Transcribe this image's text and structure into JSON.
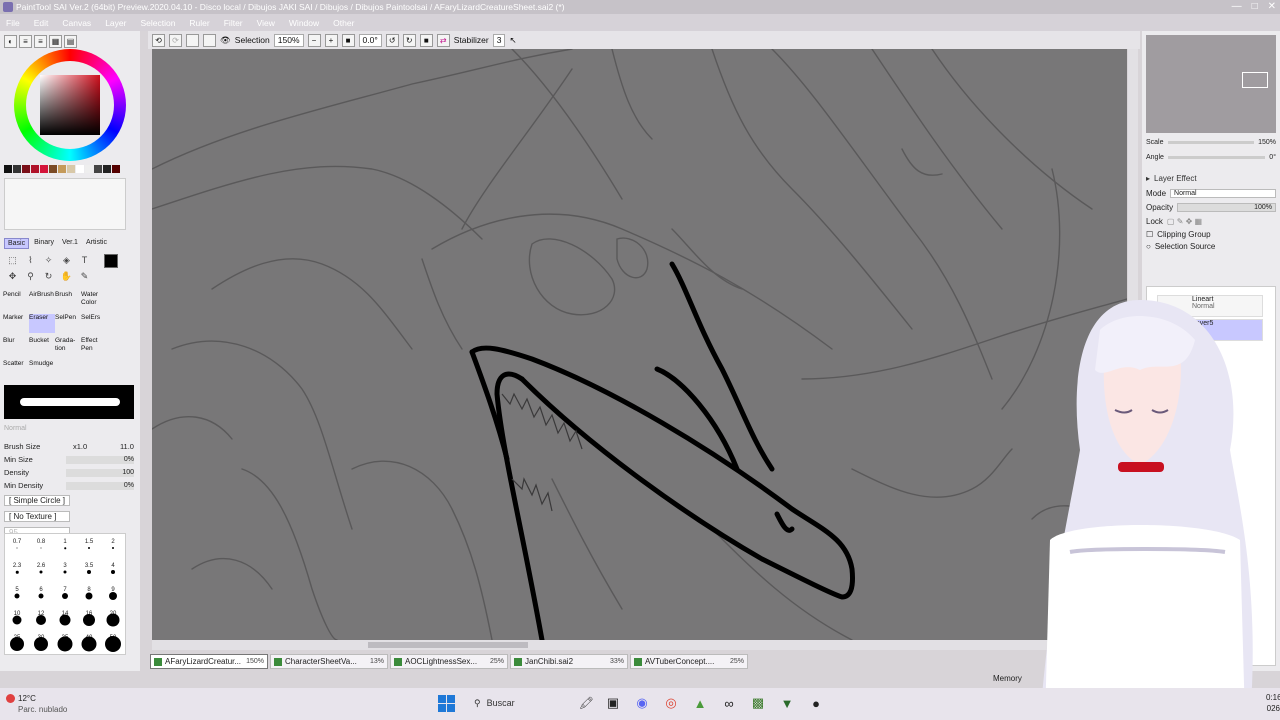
{
  "window": {
    "title": "PaintTool SAI Ver.2 (64bit) Preview.2020.04.10 - Disco local / Dibujos JAKI SAI / Dibujos / Dibujos Paintoolsai / AFaryLizardCreatureSheet.sai2 (*)",
    "controls": [
      "—",
      "□",
      "✕"
    ]
  },
  "menu": {
    "items": [
      "File",
      "Edit",
      "Canvas",
      "Layer",
      "Selection",
      "Ruler",
      "Filter",
      "View",
      "Window",
      "Other"
    ]
  },
  "toolbar": {
    "selection_label": "Selection",
    "zoom": "150%",
    "rotation": "0.0°",
    "stabilizer_label": "Stabilizer",
    "stabilizer_value": "3"
  },
  "color_swatches": [
    "#111111",
    "#333333",
    "#7a0f18",
    "#b0122a",
    "#d4143a",
    "#7a4a25",
    "#c49a5a",
    "#d8c8a8",
    "#ffffff",
    "#eeeeee",
    "#444444",
    "#222222",
    "#550000"
  ],
  "toolset_tabs": [
    "Basic",
    "Binary",
    "Ver.1",
    "Artistic"
  ],
  "tools": [
    {
      "label": "Pencil",
      "selected": false
    },
    {
      "label": "AirBrush",
      "selected": false
    },
    {
      "label": "Brush",
      "selected": false
    },
    {
      "label": "Water Color",
      "selected": false
    },
    {
      "label": "",
      "selected": false
    },
    {
      "label": "Marker",
      "selected": false
    },
    {
      "label": "Eraser",
      "selected": true
    },
    {
      "label": "SelPen",
      "selected": false
    },
    {
      "label": "SelErs",
      "selected": false
    },
    {
      "label": "",
      "selected": false
    },
    {
      "label": "Blur",
      "selected": false
    },
    {
      "label": "Bucket",
      "selected": false
    },
    {
      "label": "Grada- tion",
      "selected": false
    },
    {
      "label": "Effect Pen",
      "selected": false
    },
    {
      "label": "",
      "selected": false
    },
    {
      "label": "Scatter",
      "selected": false
    },
    {
      "label": "Smudge",
      "selected": false
    }
  ],
  "brush": {
    "mode": "Normal",
    "size_label": "Brush Size",
    "size_multiplier": "x1.0",
    "size_value": "11.0",
    "min_size_label": "Min Size",
    "min_size_value": "0%",
    "density_label": "Density",
    "density_value": "100",
    "min_density_label": "Min Density",
    "min_density_value": "0%",
    "shape": "[ Simple Circle ]",
    "texture": "[ No Texture ]",
    "texture_value": "95"
  },
  "brush_sizes": [
    {
      "label": "0.7",
      "d": 1
    },
    {
      "label": "0.8",
      "d": 1
    },
    {
      "label": "1",
      "d": 1.5
    },
    {
      "label": "1.5",
      "d": 2
    },
    {
      "label": "2",
      "d": 2
    },
    {
      "label": "2.3",
      "d": 2.5
    },
    {
      "label": "2.6",
      "d": 3
    },
    {
      "label": "3",
      "d": 3
    },
    {
      "label": "3.5",
      "d": 4
    },
    {
      "label": "4",
      "d": 4
    },
    {
      "label": "5",
      "d": 5
    },
    {
      "label": "6",
      "d": 5
    },
    {
      "label": "7",
      "d": 6
    },
    {
      "label": "8",
      "d": 7
    },
    {
      "label": "9",
      "d": 8
    },
    {
      "label": "10",
      "d": 9
    },
    {
      "label": "12",
      "d": 10
    },
    {
      "label": "14",
      "d": 11
    },
    {
      "label": "16",
      "d": 12
    },
    {
      "label": "20",
      "d": 13
    },
    {
      "label": "25",
      "d": 14
    },
    {
      "label": "30",
      "d": 14
    },
    {
      "label": "35",
      "d": 15
    },
    {
      "label": "40",
      "d": 15
    },
    {
      "label": "50",
      "d": 16
    }
  ],
  "navigator": {
    "scale_label": "Scale",
    "scale_value": "150%",
    "angle_label": "Angle",
    "angle_value": "0°"
  },
  "layer_panel": {
    "effect_label": "Layer Effect",
    "mode_label": "Mode",
    "mode_value": "Normal",
    "opacity_label": "Opacity",
    "opacity_value": "100%",
    "lock_label": "Lock",
    "clipping_label": "Clipping Group",
    "selection_source_label": "Selection Source",
    "layers": [
      {
        "name": "Lineart",
        "mode": "Normal",
        "selected": false
      },
      {
        "name": "Layer5",
        "mode": "",
        "selected": true
      }
    ]
  },
  "file_tabs": [
    {
      "name": "AFaryLizardCreatur...",
      "zoom": "150%",
      "active": true
    },
    {
      "name": "CharacterSheetVa...",
      "zoom": "13%",
      "active": false
    },
    {
      "name": "AOCLightnessSex...",
      "zoom": "25%",
      "active": false
    },
    {
      "name": "JanChibi.sai2",
      "zoom": "33%",
      "active": false
    },
    {
      "name": "AVTuberConcept....",
      "zoom": "25%",
      "active": false
    }
  ],
  "status": {
    "memory_label": "Memory"
  },
  "taskbar": {
    "weather_temp": "12°C",
    "weather_condition": "Parc. nublado",
    "search_placeholder": "Buscar",
    "time": "0:16",
    "date": "026"
  }
}
